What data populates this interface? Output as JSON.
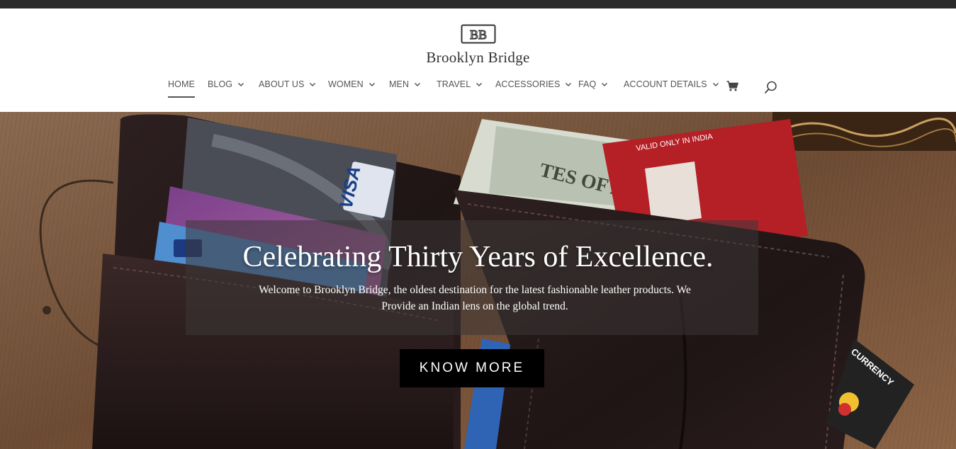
{
  "brand": {
    "monogram": "BB",
    "name": "Brooklyn Bridge"
  },
  "nav": {
    "items": [
      {
        "label": "HOME",
        "active": true,
        "dropdown": false
      },
      {
        "label": "BLOG",
        "dropdown": true
      },
      {
        "label": "ABOUT US",
        "dropdown": true
      },
      {
        "label": "WOMEN",
        "dropdown": true
      },
      {
        "label": "MEN",
        "dropdown": true
      },
      {
        "label": "TRAVEL",
        "dropdown": true
      },
      {
        "label": "ACCESSORIES",
        "dropdown": true
      },
      {
        "label": "FAQ",
        "dropdown": true
      },
      {
        "label": "ACCOUNT DETAILS",
        "dropdown": true
      }
    ],
    "icons": [
      "cart-icon",
      "search-icon"
    ]
  },
  "hero": {
    "headline": "Celebrating Thirty Years of Excellence.",
    "subline_1": "Welcome to Brooklyn Bridge, the oldest destination for the latest fashionable leather products. We",
    "subline_2": "Provide an Indian lens on the global trend.",
    "cta_label": "KNOW MORE",
    "image_text": {
      "card_visa": "VISA",
      "card_india": "VALID ONLY IN INDIA",
      "card_currency": "CURRENCY",
      "bill_text": "TES OF AMERICA"
    }
  },
  "colors": {
    "topbar": "#2a2a2a",
    "nav_text": "#555555",
    "cta_bg": "#000000",
    "overlay": "rgba(60,55,55,0.55)"
  }
}
